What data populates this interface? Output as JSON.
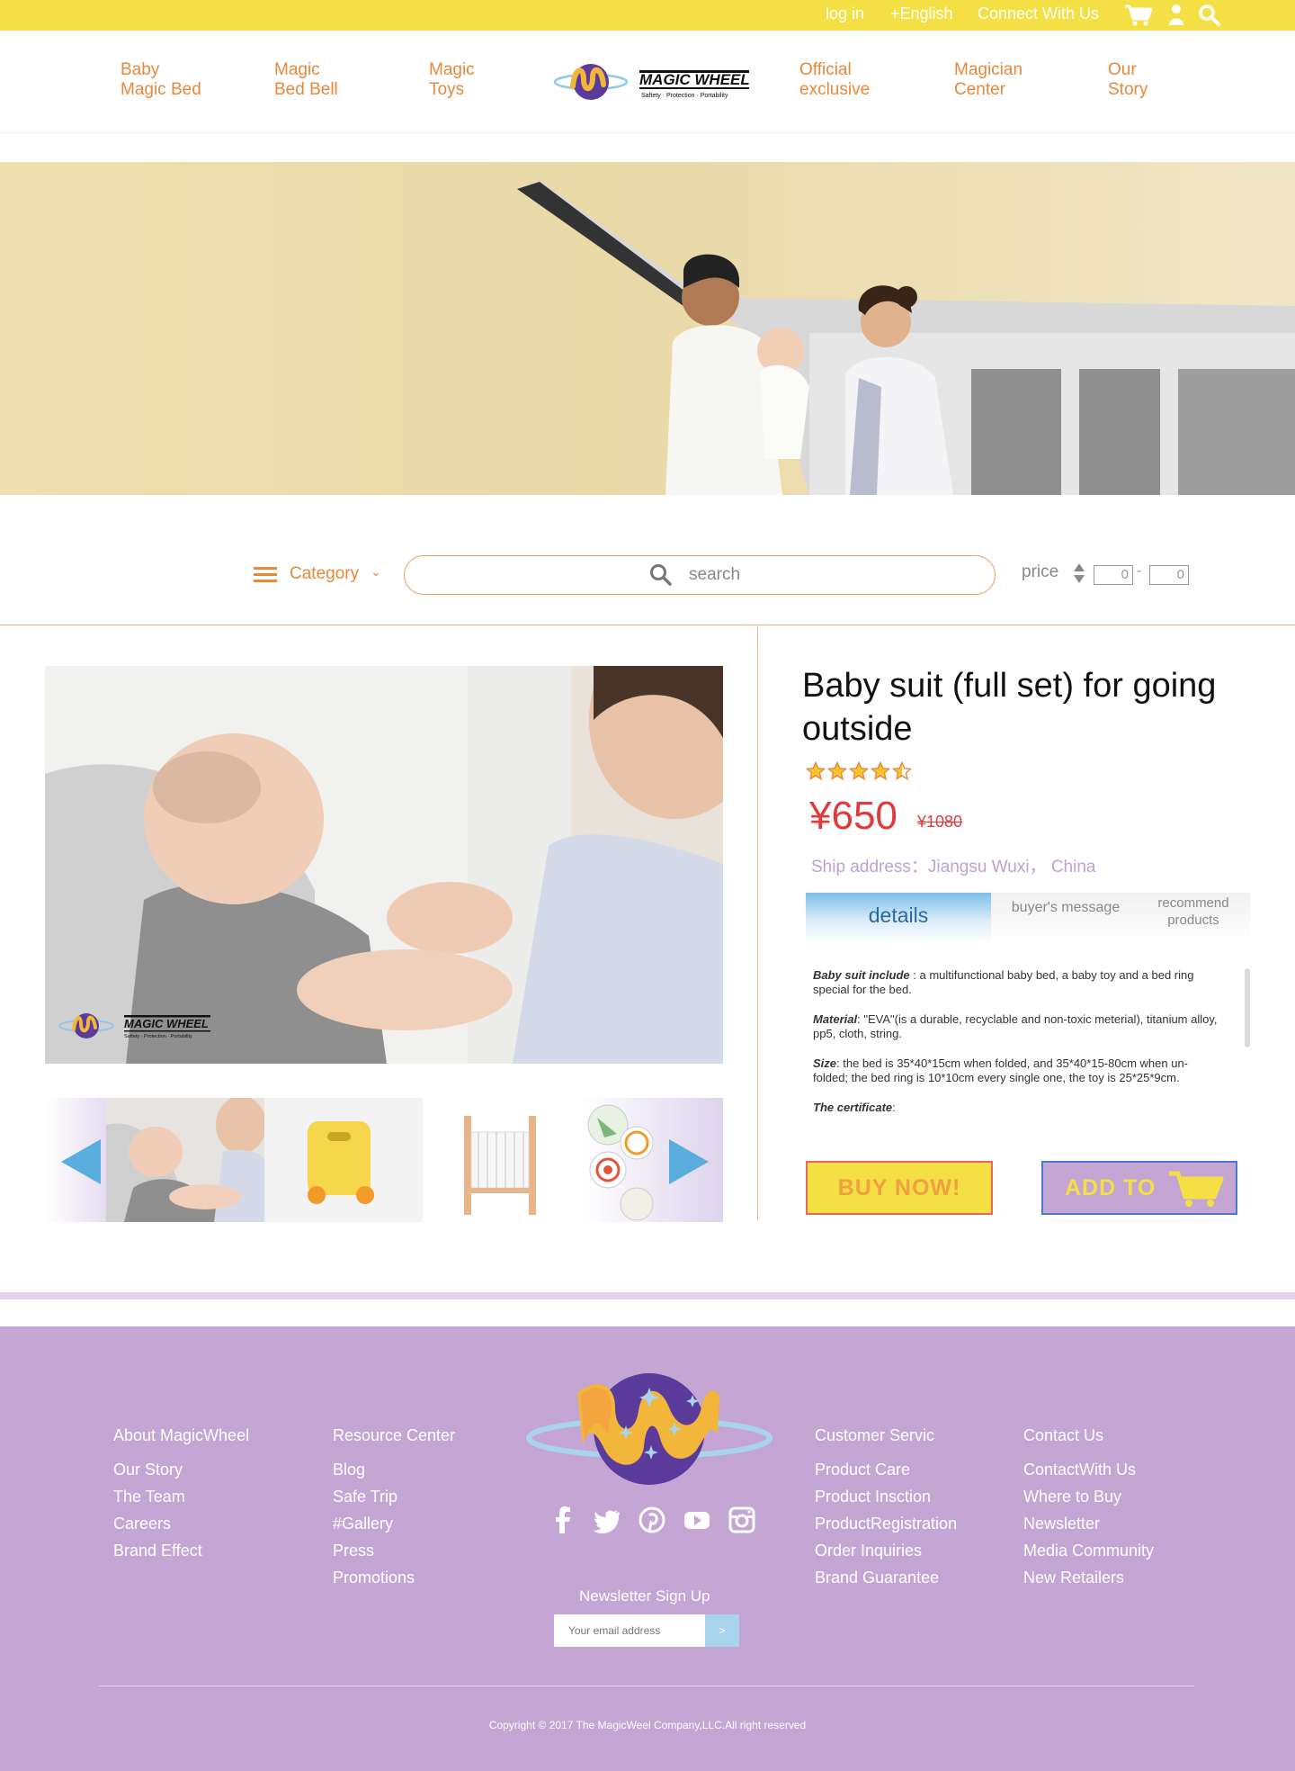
{
  "topbar": {
    "login": "log in",
    "language": "+English",
    "connect": "Connect With Us",
    "icons": [
      "cart-icon",
      "user-icon",
      "search-icon"
    ]
  },
  "nav": {
    "left": [
      "Baby\nMagic Bed",
      "Magic\nBed Bell",
      "Magic\nToys"
    ],
    "right": [
      "Official\nexclusive",
      "Magician\nCenter",
      "Our\nStory"
    ],
    "logo_text": "MAGIC WHEEL",
    "logo_tagline": "Saftety · Protection · Portability"
  },
  "filters": {
    "category_label": "Category",
    "search_placeholder": "search",
    "price_label": "price",
    "price_min": "0",
    "price_max": "0"
  },
  "product": {
    "title": "Baby suit (full set) for going outside",
    "rating": 4.5,
    "price": "¥650",
    "old_price": "¥1080",
    "ship_address": "Ship address：Jiangsu Wuxi，  China",
    "photo_logo_text": "MAGIC WHEEL",
    "photo_logo_tagline": "Saftety · Protection · Portability",
    "tabs": {
      "details": "details",
      "message": "buyer's message",
      "recommend": "recommend\nproducts"
    },
    "description": [
      {
        "label": "Baby suit include",
        "sep": " : ",
        "text": "a multifunctional baby bed, a baby toy and a bed ring special for the bed."
      },
      {
        "label": "Material",
        "sep": ": ",
        "text": "\"EVA\"(is a durable, recyclable and non-toxic meterial), titanium alloy, pp5, cloth, string."
      },
      {
        "label": "Size",
        "sep": ": ",
        "text": "the bed is 35*40*15cm when folded, and 35*40*15-80cm when un-folded; the  bed ring is 10*10cm every single one, the toy is 25*25*9cm."
      },
      {
        "label": "The certificate",
        "sep": ": ",
        "text": ""
      }
    ],
    "buy_label": "BUY NOW!",
    "add_label": "ADD TO"
  },
  "footer": {
    "col1": {
      "heading": "About MagicWheel",
      "links": [
        "Our Story",
        "The Team",
        "Careers",
        "Brand Effect"
      ]
    },
    "col2": {
      "heading": "Resource Center",
      "links": [
        "Blog",
        "Safe Trip",
        "#Gallery",
        "Press",
        "Promotions"
      ]
    },
    "col3": {
      "heading": "Customer Servic",
      "links": [
        "Product Care",
        "Product Insction",
        "ProductRegistration",
        "Order Inquiries",
        "Brand Guarantee"
      ]
    },
    "col4": {
      "heading": "Contact Us",
      "links": [
        "ContactWith Us",
        "Where to Buy",
        "Newsletter",
        "Media Community",
        "New Retailers"
      ]
    },
    "newsletter_title": "Newsletter Sign Up",
    "email_placeholder": "Your email address",
    "submit_label": ">",
    "copyright": "Copyright © 2017 The MagicWeel Company,LLC.All right reserved"
  },
  "colors": {
    "topbar": "#f4df45",
    "accent_orange": "#e8883a",
    "price_red": "#e23a3a",
    "footer_purple": "#c5a5d4",
    "tab_blue": "#7cc0ea"
  }
}
